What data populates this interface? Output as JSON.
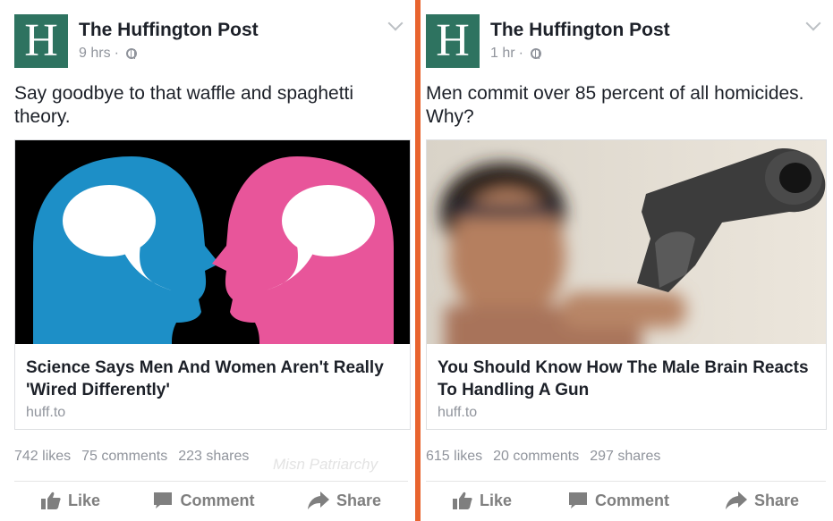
{
  "posts": [
    {
      "logo_letter": "H",
      "author": "The Huffington Post",
      "time": "9 hrs",
      "separator": "·",
      "caption": "Say goodbye to that waffle and spaghetti theory.",
      "link_title": "Science Says Men And Women Aren't Really 'Wired Differently'",
      "link_domain": "huff.to",
      "likes": "742 likes",
      "comments": "75 comments",
      "shares": "223 shares",
      "like_label": "Like",
      "comment_label": "Comment",
      "share_label": "Share"
    },
    {
      "logo_letter": "H",
      "author": "The Huffington Post",
      "time": "1 hr",
      "separator": "·",
      "caption": "Men commit over 85 percent of all homicides. Why?",
      "link_title": "You Should Know How The Male Brain Reacts To Handling A Gun",
      "link_domain": "huff.to",
      "likes": "615 likes",
      "comments": "20 comments",
      "shares": "297 shares",
      "like_label": "Like",
      "comment_label": "Comment",
      "share_label": "Share"
    }
  ],
  "watermark": "Misn Patriarchy",
  "colors": {
    "brand_green": "#2e7360",
    "divider": "#e8642e",
    "meta_gray": "#90949c",
    "head_blue": "#1d8fc7",
    "head_pink": "#e8559a"
  }
}
